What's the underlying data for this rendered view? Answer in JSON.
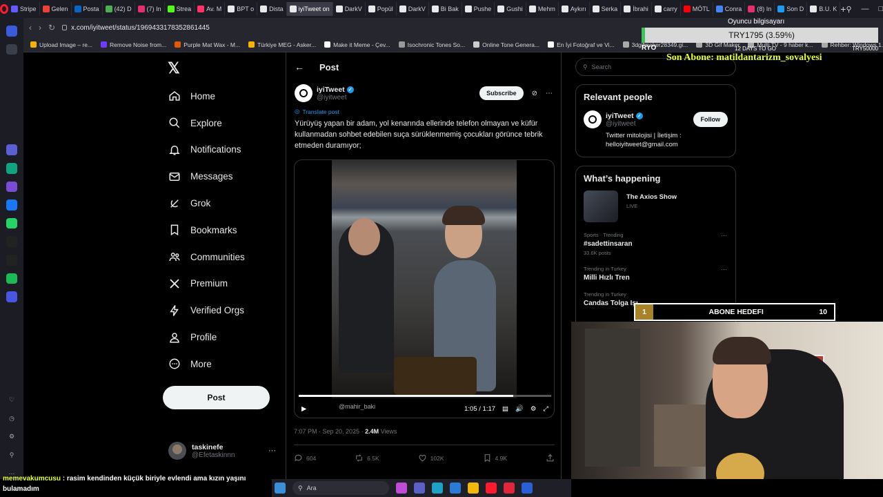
{
  "browser": {
    "tabs": [
      {
        "label": "Stripe",
        "color": "#635bff"
      },
      {
        "label": "Gelen",
        "color": "#ea4335"
      },
      {
        "label": "Posta",
        "color": "#0a66c2"
      },
      {
        "label": "(42) D",
        "color": "#4caf50"
      },
      {
        "label": "(7) In",
        "color": "#e1306c"
      },
      {
        "label": "Strea",
        "color": "#53fc18"
      },
      {
        "label": "Av. M",
        "color": "#ff3366"
      },
      {
        "label": "BPT o",
        "color": "#e7e9ea"
      },
      {
        "label": "Dista",
        "color": "#e7e9ea"
      },
      {
        "label": "iyiTweet on",
        "color": "#e7e9ea",
        "active": true
      },
      {
        "label": "DarkV",
        "color": "#e7e9ea"
      },
      {
        "label": "Popül",
        "color": "#e7e9ea"
      },
      {
        "label": "DarkV",
        "color": "#e7e9ea"
      },
      {
        "label": "Bi Bak",
        "color": "#e7e9ea"
      },
      {
        "label": "Pushe",
        "color": "#e7e9ea"
      },
      {
        "label": "Gushi",
        "color": "#e7e9ea"
      },
      {
        "label": "Mehm",
        "color": "#e7e9ea"
      },
      {
        "label": "Aykırı",
        "color": "#e7e9ea"
      },
      {
        "label": "Serka",
        "color": "#e7e9ea"
      },
      {
        "label": "İbrahi",
        "color": "#e7e9ea"
      },
      {
        "label": "carry",
        "color": "#e7e9ea"
      },
      {
        "label": "MÖTL",
        "color": "#ff0000"
      },
      {
        "label": "Conra",
        "color": "#4285f4"
      },
      {
        "label": "(8) In",
        "color": "#e1306c"
      },
      {
        "label": "Son D",
        "color": "#1d9bf0"
      },
      {
        "label": "B.U. K",
        "color": "#e7e9ea"
      }
    ],
    "new_tab": "+",
    "url": "x.com/iyitweet/status/1969433178352861445",
    "bookmarks": [
      {
        "label": "Upload Image – re...",
        "color": "#f5b400"
      },
      {
        "label": "Remove Noise from...",
        "color": "#6c3bff"
      },
      {
        "label": "Purple Mat Wax - M...",
        "color": "#e05a00"
      },
      {
        "label": "Türkiye MEG - Asker...",
        "color": "#f5b400"
      },
      {
        "label": "Make it Meme - Çev...",
        "color": "#ffffff"
      },
      {
        "label": "Isochronic Tones So...",
        "color": "#999999"
      },
      {
        "label": "Online Tone Genera...",
        "color": "#cccccc"
      },
      {
        "label": "En İyi Fotoğraf ve Vi...",
        "color": "#ffffff"
      },
      {
        "label": "3dgifmaker28349.gi...",
        "color": "#aaaaaa"
      },
      {
        "label": "3D Gif Maker",
        "color": "#aaaaaa"
      },
      {
        "label": "Multi TV - 9 haber k...",
        "color": "#aaaaaa"
      },
      {
        "label": "Rehber: Windows 1...",
        "color": "#aaaaaa"
      }
    ]
  },
  "opera_sidebar": {
    "icons": [
      {
        "name": "home-icon",
        "color": "#3b5bdb"
      },
      {
        "name": "star-icon",
        "color": "#3b3f4a"
      },
      {
        "name": "aria-icon",
        "color": "#5b5fd6"
      },
      {
        "name": "chatgpt-icon",
        "color": "#10a37f"
      },
      {
        "name": "cs-icon",
        "color": "#7b4bd6"
      },
      {
        "name": "messenger-icon",
        "color": "#1877f2"
      },
      {
        "name": "whatsapp-icon",
        "color": "#25d366"
      },
      {
        "name": "tiktok-icon",
        "color": "#222222"
      },
      {
        "name": "x-icon",
        "color": "#222222"
      },
      {
        "name": "spotify-icon",
        "color": "#1db954"
      },
      {
        "name": "player-icon",
        "color": "#4a56e2"
      }
    ]
  },
  "nav": {
    "items": [
      {
        "label": "Home",
        "icon": "home-icon"
      },
      {
        "label": "Explore",
        "icon": "search-icon"
      },
      {
        "label": "Notifications",
        "icon": "bell-icon"
      },
      {
        "label": "Messages",
        "icon": "mail-icon"
      },
      {
        "label": "Grok",
        "icon": "grok-icon"
      },
      {
        "label": "Bookmarks",
        "icon": "bookmark-icon"
      },
      {
        "label": "Communities",
        "icon": "people-icon"
      },
      {
        "label": "Premium",
        "icon": "x-premium-icon"
      },
      {
        "label": "Verified Orgs",
        "icon": "bolt-icon"
      },
      {
        "label": "Profile",
        "icon": "person-icon"
      },
      {
        "label": "More",
        "icon": "more-circle-icon"
      }
    ],
    "post_label": "Post"
  },
  "account": {
    "name": "taskinefe",
    "handle": "@Efetaskinnn",
    "more": "···"
  },
  "post": {
    "header_title": "Post",
    "author_name": "iyiTweet",
    "author_handle": "@iyitweet",
    "subscribe_label": "Subscribe",
    "translate_label": "Translate post",
    "text": "Yürüyüş yapan bir adam, yol kenarında ellerinde telefon olmayan ve küfür kullanmadan sohbet edebilen suça sürüklenmemiş çocukları görünce tebrik etmeden duramıyor;",
    "video": {
      "watermark": "@mahir_baki",
      "time": "1:05 / 1:17",
      "progress": 0.85
    },
    "time": "7:07 PM · Sep 20, 2025 · ",
    "views_count": "2.4M",
    "views_label": " Views",
    "actions": {
      "replies": "604",
      "reposts": "6.5K",
      "likes": "102K",
      "bookmarks": "4.9K"
    }
  },
  "right": {
    "search_placeholder": "Search",
    "relevant_title": "Relevant people",
    "relevant_person": {
      "name": "iyiTweet",
      "handle": "@iyitweet",
      "follow_label": "Follow",
      "bio": "Twitter mitolojisi | İletişim : helloiyitweet@gmail.com"
    },
    "happening_title": "What’s happening",
    "show": {
      "title": "The Axios Show",
      "status": "LIVE"
    },
    "trends": [
      {
        "category": "Sports · Trending",
        "name": "#sadettinsaran",
        "posts": "33.6K posts"
      },
      {
        "category": "Trending in Turkey",
        "name": "Milli Hızlı Tren",
        "posts": ""
      },
      {
        "category": "Trending in Turkey",
        "name": "Candas Tolga Işı",
        "posts": ""
      }
    ]
  },
  "overlay": {
    "pc_label": "Oyuncu bilgisayarı",
    "price": "TRY1795 (3.59%)",
    "ryo": "RYO",
    "days": "12 DAYS TO GO",
    "goal": "TRY50000",
    "last_sub": "Son Abone: matildantarizm_sovalyesi",
    "sub_goal": {
      "current": "1",
      "label": "ABONE HEDEFI",
      "target": "10"
    }
  },
  "chat": {
    "user": "memevakumcusu",
    "message": " : rasim kendinden küçük biriyle evlendi ama kızın yaşını bulamadım"
  },
  "taskbar": {
    "search_label": "Ara",
    "icons": [
      {
        "name": "windows-icon",
        "color": "#3a8fd8"
      },
      {
        "name": "copilot-icon",
        "color": "#c04cd6"
      },
      {
        "name": "teams-icon",
        "color": "#5b5fc7"
      },
      {
        "name": "edge-icon",
        "color": "#1da1c4"
      },
      {
        "name": "store-icon",
        "color": "#2b7bd6"
      },
      {
        "name": "explorer-icon",
        "color": "#f2b80c"
      },
      {
        "name": "opera-icon",
        "color": "#ff1b2d"
      },
      {
        "name": "app-w-icon",
        "color": "#e0263a"
      },
      {
        "name": "app-l-icon",
        "color": "#2b5fd6"
      }
    ]
  }
}
